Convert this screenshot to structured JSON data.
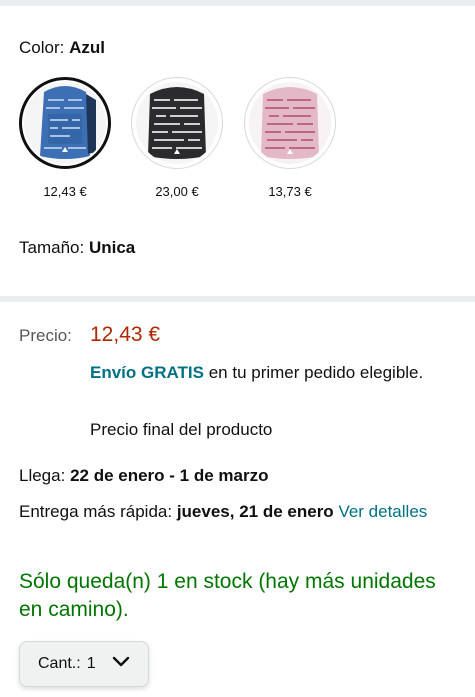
{
  "color": {
    "label": "Color:",
    "value": "Azul"
  },
  "swatches": [
    {
      "name": "blue",
      "price": "12,43 €",
      "selected": true,
      "bg": "#3d6fb4",
      "accent": "#a9c3e8"
    },
    {
      "name": "black",
      "price": "23,00 €",
      "selected": false,
      "bg": "#2b2b2e",
      "accent": "#cfcfd2"
    },
    {
      "name": "pink",
      "price": "13,73 €",
      "selected": false,
      "bg": "#e4b9c7",
      "accent": "#b14c6e"
    }
  ],
  "size": {
    "label": "Tamaño:",
    "value": "Unica"
  },
  "price": {
    "label": "Precio:",
    "value": "12,43 €"
  },
  "shipping": {
    "free": "Envío GRATIS",
    "rest": " en tu primer pedido elegible."
  },
  "final_price_text": "Precio final del producto",
  "arrival": {
    "label": "Llega:",
    "value": "22 de enero - 1 de marzo"
  },
  "fastest": {
    "label": "Entrega más rápida:",
    "value": "jueves, 21 de enero",
    "link": "Ver detalles"
  },
  "stock": "Sólo queda(n) 1 en stock (hay más unidades en camino).",
  "quantity": {
    "label": "Cant.:",
    "value": "1"
  },
  "colors": {
    "price_red": "#b12704",
    "link_teal": "#007185",
    "stock_green": "#007600",
    "divider": "#eaeded"
  }
}
